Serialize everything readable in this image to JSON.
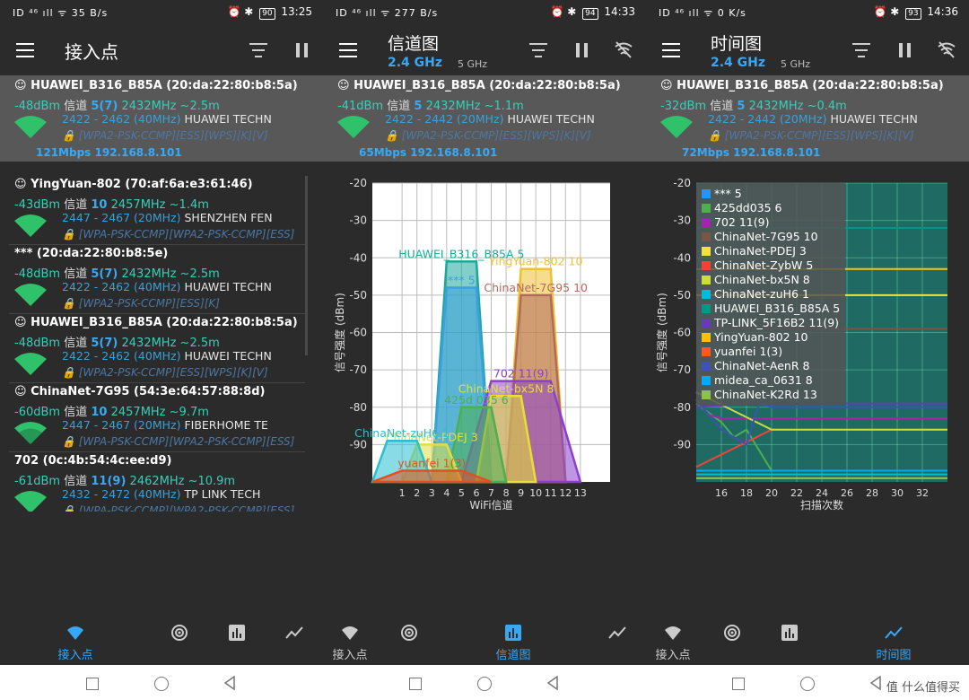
{
  "screens": [
    {
      "status": {
        "left": "ID ⁴⁶ ıll ᯤ 35 B/s",
        "battery": "90",
        "time": "13:25"
      },
      "title": "接入点",
      "aps": [
        {
          "name": "HUAWEI_B316_B85A (20:da:22:80:b8:5a)",
          "dbm": "-48dBm",
          "ch_label": "信道",
          "ch": "5(7)",
          "mhz": "2432MHz",
          "dist": "~2.5m",
          "range": "2422 - 2462 (40MHz)",
          "vendor": "HUAWEI TECHN",
          "sec": "[WPA2-PSK-CCMP][ESS][WPS][K][V]",
          "rate": "121Mbps 192.168.8.101"
        },
        {
          "name": "YingYuan-802 (70:af:6a:e3:61:46)",
          "dbm": "-43dBm",
          "ch_label": "信道",
          "ch": "10",
          "mhz": "2457MHz",
          "dist": "~1.4m",
          "range": "2447 - 2467 (20MHz)",
          "vendor": "SHENZHEN FEN",
          "sec": "[WPA-PSK-CCMP][WPA2-PSK-CCMP][ESS]"
        },
        {
          "name": "*** (20:da:22:80:b8:5e)",
          "dbm": "-48dBm",
          "ch_label": "信道",
          "ch": "5(7)",
          "mhz": "2432MHz",
          "dist": "~2.5m",
          "range": "2422 - 2462 (40MHz)",
          "vendor": "HUAWEI TECHN",
          "sec": "[WPA2-PSK-CCMP][ESS][K]"
        },
        {
          "name": "HUAWEI_B316_B85A (20:da:22:80:b8:5a)",
          "dbm": "-48dBm",
          "ch_label": "信道",
          "ch": "5(7)",
          "mhz": "2432MHz",
          "dist": "~2.5m",
          "range": "2422 - 2462 (40MHz)",
          "vendor": "HUAWEI TECHN",
          "sec": "[WPA2-PSK-CCMP][ESS][WPS][K][V]"
        },
        {
          "name": "ChinaNet-7G95 (54:3e:64:57:88:8d)",
          "dbm": "-60dBm",
          "ch_label": "信道",
          "ch": "10",
          "mhz": "2457MHz",
          "dist": "~9.7m",
          "range": "2447 - 2467 (20MHz)",
          "vendor": "FIBERHOME TE",
          "sec": "[WPA-PSK-CCMP][WPA2-PSK-CCMP][ESS]"
        },
        {
          "name": "702 (0c:4b:54:4c:ee:d9)",
          "dbm": "-61dBm",
          "ch_label": "信道",
          "ch": "11(9)",
          "mhz": "2462MHz",
          "dist": "~10.9m",
          "range": "2432 - 2472 (40MHz)",
          "vendor": "TP LINK TECH",
          "sec": "[WPA-PSK-CCMP][WPA2-PSK-CCMP][ESS]"
        }
      ],
      "nav": {
        "ap_label": "接入点"
      }
    },
    {
      "status": {
        "left": "ID ⁴⁶ ıll ᯤ 277 B/s",
        "battery": "94",
        "time": "14:33"
      },
      "title": "信道图",
      "band": "2.4 GHz",
      "band2": "5 GHz",
      "ap": {
        "name": "HUAWEI_B316_B85A (20:da:22:80:b8:5a)",
        "dbm": "-41dBm",
        "ch_label": "信道",
        "ch": "5",
        "mhz": "2432MHz",
        "dist": "~1.1m",
        "range": "2422 - 2442 (20MHz)",
        "vendor": "HUAWEI TECHN",
        "sec": "[WPA2-PSK-CCMP][ESS][WPS][K][V]",
        "rate": "65Mbps 192.168.8.101"
      },
      "nav": {
        "ap_label": "接入点",
        "chan_label": "信道图"
      }
    },
    {
      "status": {
        "left": "ID ⁴⁶ ıll ᯤ 0 K/s",
        "battery": "93",
        "time": "14:36"
      },
      "title": "时间图",
      "band": "2.4 GHz",
      "band2": "5 GHz",
      "ap": {
        "name": "HUAWEI_B316_B85A (20:da:22:80:b8:5a)",
        "dbm": "-32dBm",
        "ch_label": "信道",
        "ch": "5",
        "mhz": "2432MHz",
        "dist": "~0.4m",
        "range": "2422 - 2442 (20MHz)",
        "vendor": "HUAWEI TECHN",
        "sec": "[WPA2-PSK-CCMP][ESS][WPS][K][V]",
        "rate": "72Mbps 192.168.8.101"
      },
      "nav": {
        "ap_label": "接入点",
        "time_label": "时间图"
      }
    }
  ],
  "watermark": "值 什么值得买",
  "colors": {
    "accent": "#38a8f5",
    "teal": "#35d0b9",
    "signal": "#2fc26a"
  },
  "chart_data": [
    {
      "type": "area",
      "xlabel": "WiFi信道",
      "ylabel": "信号强度 (dBm)",
      "x_ticks": [
        "1",
        "2",
        "3",
        "4",
        "5",
        "6",
        "7",
        "8",
        "9",
        "10",
        "11",
        "12",
        "13"
      ],
      "y_ticks": [
        "-20",
        "-30",
        "-40",
        "-50",
        "-60",
        "-70",
        "-80",
        "-90"
      ],
      "ylim": [
        -100,
        -20
      ],
      "xlim": [
        -1,
        15
      ],
      "grid": true,
      "series": [
        {
          "name": "HUAWEI_B316_B85A 5",
          "label": "HUAWEI_B316_B85A 5",
          "center": 5,
          "half_width": 2,
          "level": -41,
          "color": "#1aa89a"
        },
        {
          "name": "*** 5",
          "label": "*** 5",
          "center": 5,
          "half_width": 2,
          "level": -48,
          "color": "#3aa0e0"
        },
        {
          "name": "YingYuan-802 10",
          "label": "YingYuan-802 10",
          "center": 10,
          "half_width": 2,
          "level": -43,
          "color": "#f0c030"
        },
        {
          "name": "ChinaNet-7G95 10",
          "label": "ChinaNet-7G95 10",
          "center": 10,
          "half_width": 2,
          "level": -50,
          "color": "#b06a5e"
        },
        {
          "name": "702 11(9)",
          "label": "702 11(9)",
          "center": 9,
          "half_width": 4,
          "level": -73,
          "color": "#8a3fd0"
        },
        {
          "name": "ChinaNet-bx5N 8",
          "label": "ChinaNet-bx5N 8",
          "center": 8,
          "half_width": 2,
          "level": -77,
          "color": "#e8e030"
        },
        {
          "name": "425dd035 6",
          "label": "425d 035 6",
          "center": 6,
          "half_width": 2,
          "level": -80,
          "color": "#4caf50"
        },
        {
          "name": "ChinaNet-PDEJ 3",
          "label": "ChinaNet-PDEJ 3",
          "center": 3,
          "half_width": 2,
          "level": -90,
          "color": "#e0e040"
        },
        {
          "name": "ChinaNet-zuH6 1",
          "label": "ChinaNet-zuH6 1",
          "center": 1,
          "half_width": 2,
          "level": -89,
          "color": "#28c0d0"
        },
        {
          "name": "yuanfei 1(3)",
          "label": "yuanfei 1(3)",
          "center": 3,
          "half_width": 4,
          "level": -97,
          "color": "#e05020"
        }
      ]
    },
    {
      "type": "line",
      "xlabel": "扫描次数",
      "ylabel": "信号强度 (dBm)",
      "x_ticks": [
        "16",
        "18",
        "20",
        "22",
        "24",
        "26",
        "28",
        "30",
        "32"
      ],
      "y_ticks": [
        "-20",
        "-30",
        "-40",
        "-50",
        "-60",
        "-70",
        "-80",
        "-90"
      ],
      "xlim": [
        14,
        34
      ],
      "ylim": [
        -100,
        -20
      ],
      "grid": true,
      "legend_position": "top-left",
      "series": [
        {
          "name": "*** 5",
          "color": "#2196f3",
          "x": [
            14,
            34
          ],
          "y": [
            -32,
            -32
          ]
        },
        {
          "name": "425dd035 6",
          "color": "#4caf50",
          "x": [
            14,
            16,
            17,
            18,
            20,
            34
          ],
          "y": [
            -79,
            -84,
            -88,
            -86,
            -97,
            -97
          ]
        },
        {
          "name": "702 11(9)",
          "color": "#9c27b0",
          "x": [
            14,
            15,
            16,
            20,
            34
          ],
          "y": [
            -78,
            -82,
            -83,
            -83,
            -83
          ]
        },
        {
          "name": "ChinaNet-7G95 10",
          "color": "#795548",
          "x": [
            14,
            34
          ],
          "y": [
            -59,
            -59
          ]
        },
        {
          "name": "ChinaNet-PDEJ 3",
          "color": "#f0e040",
          "x": [
            14,
            34
          ],
          "y": [
            -50,
            -50
          ]
        },
        {
          "name": "ChinaNet-ZybW 5",
          "color": "#f44336",
          "x": [
            14,
            20,
            34
          ],
          "y": [
            -96,
            -86,
            -86
          ]
        },
        {
          "name": "ChinaNet-bx5N 8",
          "color": "#cddc39",
          "x": [
            14,
            20,
            21,
            34
          ],
          "y": [
            -76,
            -86,
            -86,
            -86
          ]
        },
        {
          "name": "ChinaNet-zuH6 1",
          "color": "#00bcd4",
          "x": [
            14,
            34
          ],
          "y": [
            -98,
            -98
          ]
        },
        {
          "name": "HUAWEI_B316_B85A 5",
          "color": "#009688",
          "x": [
            14,
            34
          ],
          "y": [
            -32,
            -32
          ]
        },
        {
          "name": "TP-LINK_5F16B2 11(9)",
          "color": "#673ab7",
          "x": [
            14,
            18,
            34
          ],
          "y": [
            -80,
            -79,
            -79
          ]
        },
        {
          "name": "YingYuan-802 10",
          "color": "#ffc107",
          "x": [
            14,
            34
          ],
          "y": [
            -43,
            -43
          ]
        },
        {
          "name": "yuanfei 1(3)",
          "color": "#ff5722",
          "x": [
            14,
            34
          ],
          "y": [
            -99,
            -99
          ]
        },
        {
          "name": "ChinaNet-AenR 8",
          "color": "#3f51b5",
          "x": [
            14,
            16,
            18,
            19,
            20,
            34
          ],
          "y": [
            -78,
            -86,
            -90,
            -79,
            -80,
            -80
          ]
        },
        {
          "name": "midea_ca_0631 8",
          "color": "#03a9f4",
          "x": [
            14,
            34
          ],
          "y": [
            -97,
            -97
          ]
        },
        {
          "name": "ChinaNet-K2Rd 13",
          "color": "#8bc34a",
          "x": [
            14,
            34
          ],
          "y": [
            -99,
            -99
          ]
        }
      ]
    }
  ]
}
